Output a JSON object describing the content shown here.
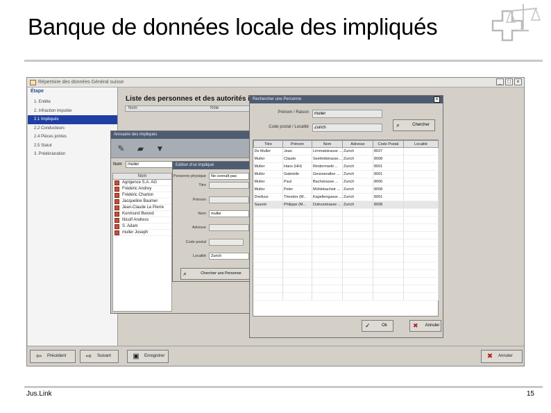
{
  "slide": {
    "title": "Banque de données locale des impliqués",
    "footer_left": "Jus.Link",
    "page_number": "15"
  },
  "window": {
    "title": "Répertoire des données Général suisse",
    "controls": [
      "_",
      "□",
      "×"
    ]
  },
  "left_pane": {
    "header": "Étape",
    "items": [
      {
        "label": "1. Entête",
        "selected": false
      },
      {
        "label": "2. Infraction imputée",
        "selected": false
      },
      {
        "label": "2.1 Impliqués",
        "selected": true
      },
      {
        "label": "2.2 Conducteurs",
        "selected": false
      },
      {
        "label": "2.4 Pièces jointes",
        "selected": false
      },
      {
        "label": "2.5 Statut",
        "selected": false
      },
      {
        "label": "3. Prédéclaration",
        "selected": false
      }
    ]
  },
  "content": {
    "heading": "Liste des personnes et des autorités im",
    "col_nom": "Nom",
    "col_role": "Rôle"
  },
  "bottom_bar": {
    "prev": "Précédent",
    "next": "Suivant",
    "save": "Enregistrer",
    "cancel": "Annuler"
  },
  "annuaire": {
    "title": "Annuaire des impliqués",
    "nom_label": "Nom",
    "nom_value": "muller",
    "list_header": "Nom",
    "rows": [
      "Agrigence S.A. AG",
      "Frédéric Andrey",
      "Frédéric Charton",
      "Jacqueline Baumer",
      "Jean-Claude Le Pierre",
      "Kunmund Bwood",
      "Nicolf Andress",
      "S. Adam",
      "muller Joseph"
    ]
  },
  "edition": {
    "title": "Edition d'un impliqué",
    "fields": [
      {
        "label": "Personne physique",
        "value": "Ne connaît pas"
      },
      {
        "label": "Titre",
        "value": ""
      },
      {
        "label": "Prénom",
        "value": ""
      },
      {
        "label": "Nom",
        "value": "muller"
      },
      {
        "label": "Adresse",
        "value": ""
      },
      {
        "label": "Code postal",
        "value": ""
      },
      {
        "label": "Localité",
        "value": "Zurich"
      }
    ],
    "search_button": "Chercher une Personne"
  },
  "recherche": {
    "title": "Rechercher une Personne",
    "prenom_label": "Prénom / Raison",
    "prenom_value": "muller",
    "code_label": "Code postal / Localité",
    "code_value": "Zurich",
    "search_button": "Chercher",
    "columns": [
      "Titre",
      "Prénom",
      "Nom",
      "Adresse",
      "Code Postal",
      "Localité"
    ],
    "rows": [
      [
        "De Muller",
        "Jean",
        "Limmatstrasse ...",
        "Zurich",
        "8037",
        ""
      ],
      [
        "Muller",
        "Claude",
        "Seefeldstrasse...",
        "Zurich",
        "8008",
        ""
      ],
      [
        "Muller",
        "Hans (HH)",
        "Rindermarkt ...",
        "Zurich",
        "8001",
        ""
      ],
      [
        "Muller",
        "Gabrielle",
        "Gessnerallee ...",
        "Zurich",
        "8001",
        ""
      ],
      [
        "Muller",
        "Paul",
        "Bachstrasse ...",
        "Zurich",
        "8006",
        ""
      ],
      [
        "Muller",
        "Peter",
        "Mühlebachstr ...",
        "Zurich",
        "8008",
        ""
      ],
      [
        "Dreifuss",
        "Theodor (M...",
        "Kapellengasse ...",
        "Zurich",
        "8001",
        ""
      ],
      [
        "Saunet",
        "Philippe (M...",
        "Dufourstrasse ...",
        "Zurich",
        "8008",
        ""
      ]
    ],
    "ok": "Ok",
    "cancel": "Annuler"
  }
}
